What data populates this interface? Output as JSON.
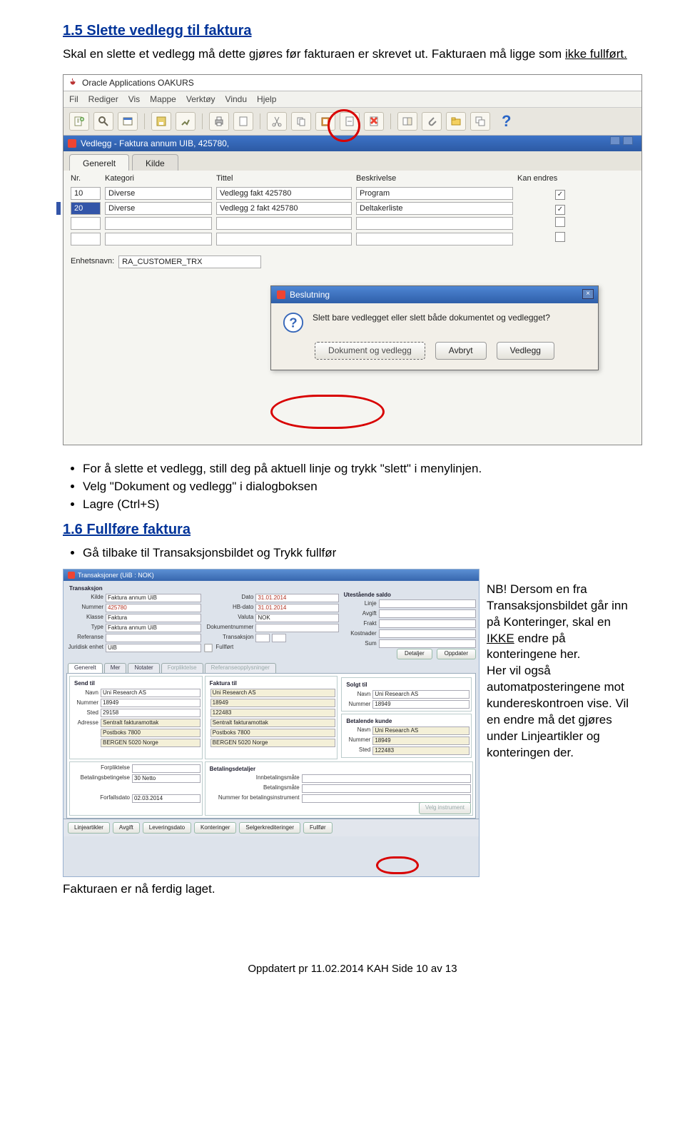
{
  "section1": {
    "heading": "1.5 Slette vedlegg til faktura",
    "intro_part1": "Skal en slette et vedlegg må dette gjøres før fakturaen er skrevet ut. Fakturaen må ligge som ",
    "intro_underlined": "ikke fullført.",
    "bullets": [
      "For å slette et vedlegg, still deg på aktuell linje og trykk \"slett\" i menylinjen.",
      "Velg \"Dokument og vedlegg\" i dialogboksen",
      "Lagre (Ctrl+S)"
    ]
  },
  "oracle_title": "Oracle Applications OAKURS",
  "menus": [
    "Fil",
    "Rediger",
    "Vis",
    "Mappe",
    "Verktøy",
    "Vindu",
    "Hjelp"
  ],
  "vedlegg_bar": "Vedlegg - Faktura annum UIB, 425780,",
  "grid": {
    "tabs": [
      "Generelt",
      "Kilde"
    ],
    "headers": [
      "Nr.",
      "Kategori",
      "Tittel",
      "Beskrivelse",
      "Kan endres"
    ],
    "rows": [
      {
        "nr": "10",
        "kat": "Diverse",
        "tittel": "Vedlegg fakt 425780",
        "besk": "Program",
        "checked": true,
        "selected": false
      },
      {
        "nr": "20",
        "kat": "Diverse",
        "tittel": "Vedlegg 2 fakt 425780",
        "besk": "Deltakerliste",
        "checked": true,
        "selected": true
      }
    ],
    "enh_label": "Enhetsnavn:",
    "enh_value": "RA_CUSTOMER_TRX"
  },
  "dialog": {
    "title": "Beslutning",
    "msg": "Slett bare vedlegget eller slett både dokumentet og vedlegget?",
    "buttons": [
      "Dokument og vedlegg",
      "Avbryt",
      "Vedlegg"
    ]
  },
  "section2": {
    "heading": "1.6 Fullføre faktura",
    "bullet1": "Gå tilbake til Transaksjonsbildet og Trykk fullfør",
    "final_line": "Fakturaen er nå ferdig laget."
  },
  "side_note": {
    "l1": "NB! Dersom en fra Transaksjonsbildet går inn på Konteringer, skal en ",
    "underlined": "IKKE",
    "l2": " endre på konteringene her.",
    "l3": "Her vil også automatposteringene mot kundereskontroen vise. Vil en endre må det gjøres under Linjeartikler og konteringen der."
  },
  "s2": {
    "title": "Transaksjoner (UiB : NOK)",
    "groups": {
      "transaksjon": "Transaksjon",
      "utestaende": "Utestående saldo"
    },
    "labels": {
      "kilde": "Kilde",
      "kilde_v": "Faktura annum UiB",
      "nummer": "Nummer",
      "nummer_v": "425780",
      "klasse": "Klasse",
      "klasse_v": "Faktura",
      "type": "Type",
      "type_v": "Faktura annum UiB",
      "referanse": "Referanse",
      "juridisk": "Juridisk enhet",
      "juridisk_v": "UiB",
      "dato": "Dato",
      "dato_v": "31.01.2014",
      "hb": "HB-dato",
      "hb_v": "31.01.2014",
      "valuta": "Valuta",
      "valuta_v": "NOK",
      "doknr": "Dokumentnummer",
      "trans": "Transaksjon",
      "fullfort": "Fullført",
      "linje": "Linje",
      "avgift": "Avgift",
      "frakt": "Frakt",
      "kost": "Kostnader",
      "sum": "Sum",
      "detaljer": "Detaljer",
      "oppdater": "Oppdater"
    },
    "tabs": [
      "Generelt",
      "Mer",
      "Notater",
      "Forpliktelse",
      "Referanseopplysninger"
    ],
    "send_til": "Send til",
    "faktura_til": "Faktura til",
    "solgt_til": "Solgt til",
    "betalende": "Betalende kunde",
    "bet_detaljer": "Betalingsdetaljer",
    "navn": "Navn",
    "navn_v": "Uni Research AS",
    "num": "Nummer",
    "num_v": "18949",
    "sted": "Sted",
    "sted1": "29158",
    "sted2": "122483",
    "sted3": "122483",
    "adresse": "Adresse",
    "adr1": "Sentralt fakturamottak",
    "adr2": "Postboks 7800",
    "adr3": "BERGEN 5020 Norge",
    "adr1b": "Sentralt fakturamottak",
    "adr2b": "Postboks 7800",
    "adr3b": "BERGEN 5020 Norge",
    "forpl": "Forpliktelse",
    "betb": "Betalingsbetingelse",
    "betb_v": "30 Netto",
    "forfall": "Forfallsdato",
    "forfall_v": "02.03.2014",
    "innbet": "Innbetalingsmåte",
    "betmate": "Betalingsmåte",
    "instr": "Nummer for betalingsinstrument",
    "velg": "Velg instrument",
    "bottom": [
      "Linjeartikler",
      "Avgift",
      "Leveringsdato",
      "Konteringer",
      "Selgerkrediteringer",
      "Fullfør"
    ]
  },
  "footer": "Oppdatert pr 11.02.2014 KAH          Side 10 av 13"
}
